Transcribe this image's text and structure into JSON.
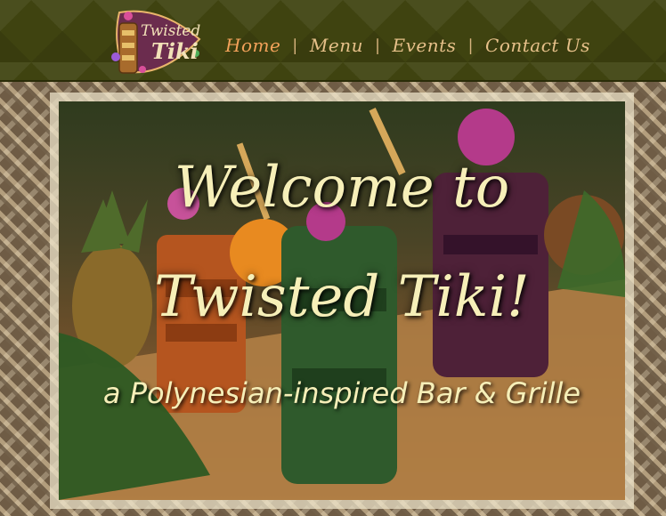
{
  "nav": {
    "logo_text_line1": "Twisted",
    "logo_text_line2": "Tiki",
    "items": [
      {
        "label": "Home",
        "active": true
      },
      {
        "label": "Menu",
        "active": false
      },
      {
        "label": "Events",
        "active": false
      },
      {
        "label": "Contact Us",
        "active": false
      }
    ],
    "separator": "|"
  },
  "hero": {
    "title_line1": "Welcome to",
    "title_line2": "Twisted Tiki!",
    "subtitle": "a Polynesian-inspired Bar & Grille"
  },
  "colors": {
    "nav_bg": "#3f4310",
    "nav_text": "#e6c089",
    "nav_active": "#f3a25a",
    "hero_text": "#f6efb8"
  }
}
